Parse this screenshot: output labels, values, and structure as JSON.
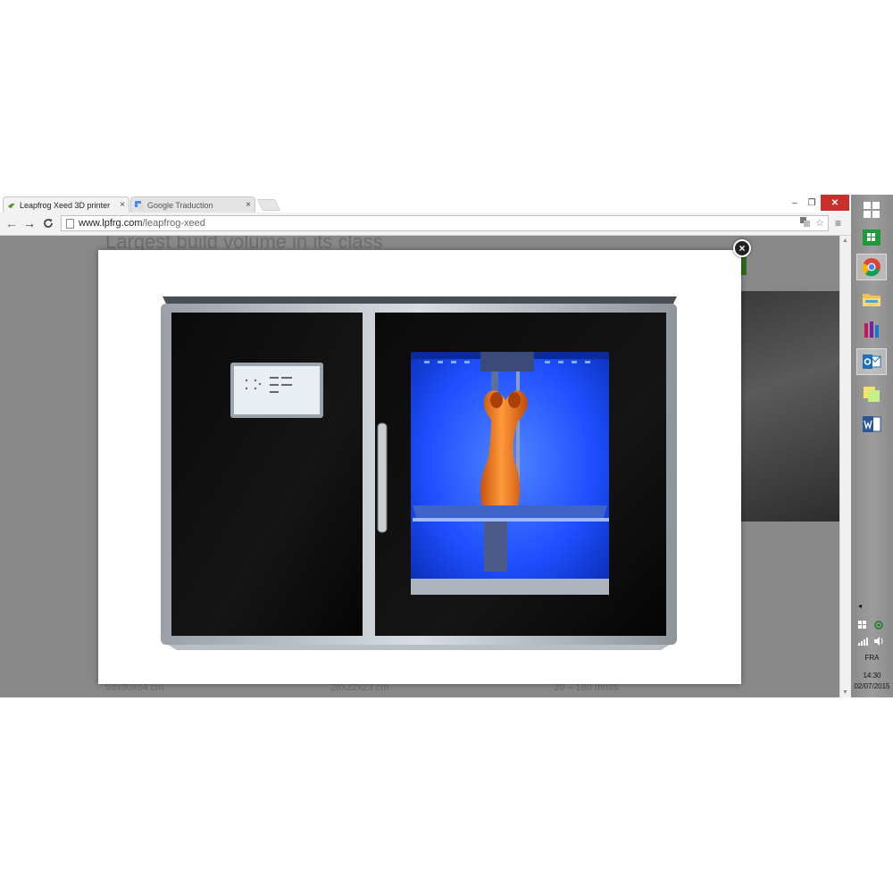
{
  "browser": {
    "tabs": [
      {
        "label": "Leapfrog Xeed 3D printer",
        "close": "×",
        "active": true
      },
      {
        "label": "Google Traduction",
        "close": "×",
        "active": false
      }
    ],
    "window_controls": {
      "minimize": "–",
      "restore": "❐",
      "close": "✕"
    },
    "nav": {
      "back": "←",
      "forward": "→",
      "reload": "C"
    },
    "address": {
      "host": "www.lpfrg.com",
      "path": "/leapfrog-xeed"
    },
    "menu_icon": "≡"
  },
  "page": {
    "background_heading": "Largest build volume in its class",
    "specs": [
      "58x90x64 cm",
      "28x22x23 cm",
      "30 – 180 mm/s"
    ]
  },
  "lightbox": {
    "close_label": "×",
    "image_subject": "Leapfrog Xeed 3D printer with orange printed torso"
  },
  "taskbar": {
    "icons": [
      "windows-start-icon",
      "store-icon",
      "chrome-icon",
      "file-explorer-icon",
      "app-icon",
      "outlook-icon",
      "sticky-notes-icon",
      "word-icon"
    ],
    "tray": {
      "language": "FRA",
      "time": "14:30",
      "date": "02/07/2015"
    }
  },
  "colors": {
    "page_overlay": "#888888",
    "chrome_close": "#c9302c",
    "printer_glow": "#1f4fff",
    "print_orange": "#f07a1a"
  }
}
